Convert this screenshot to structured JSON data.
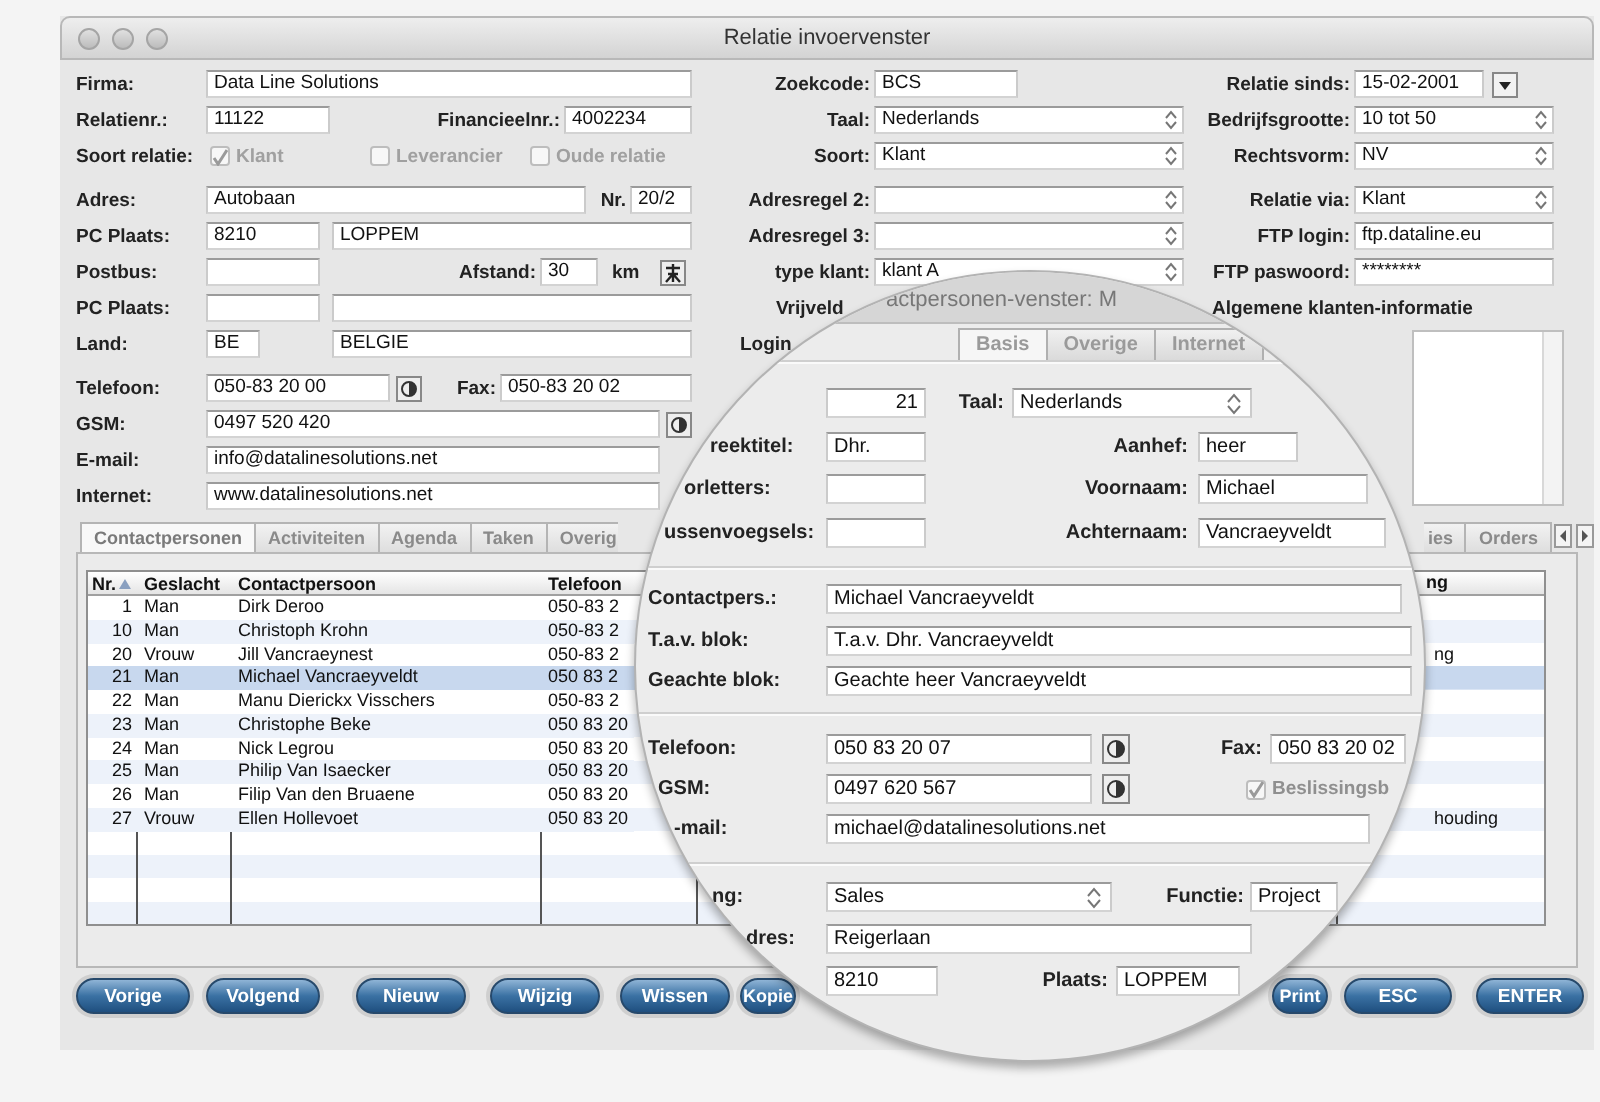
{
  "window": {
    "title": "Relatie invoervenster"
  },
  "form": {
    "left": [
      [
        {
          "kind": "label",
          "text": "Firma:"
        },
        {
          "kind": "field",
          "value": "Data Line Solutions"
        }
      ],
      [
        {
          "kind": "label",
          "text": "Relatienr.:"
        },
        {
          "kind": "field",
          "value": "11122"
        },
        {
          "kind": "label",
          "text": "Financieelnr.:"
        },
        {
          "kind": "field",
          "value": "4002234"
        }
      ],
      [
        {
          "kind": "label",
          "text": "Soort relatie:"
        },
        {
          "kind": "check",
          "text": "Klant",
          "checked": true,
          "disabled": true
        },
        {
          "kind": "check",
          "text": "Leverancier",
          "checked": false,
          "disabled": true
        },
        {
          "kind": "check",
          "text": "Oude relatie",
          "checked": false,
          "disabled": true
        }
      ],
      [
        {
          "kind": "label",
          "text": "Adres:"
        },
        {
          "kind": "field",
          "value": "Autobaan"
        },
        {
          "kind": "label",
          "text": "Nr."
        },
        {
          "kind": "field",
          "value": "20/2"
        }
      ],
      [
        {
          "kind": "label",
          "text": "PC Plaats:"
        },
        {
          "kind": "field",
          "value": "8210"
        },
        {
          "kind": "field",
          "value": "LOPPEM"
        }
      ],
      [
        {
          "kind": "label",
          "text": "Postbus:"
        },
        {
          "kind": "field"
        },
        {
          "kind": "label",
          "text": "Afstand:"
        },
        {
          "kind": "field",
          "value": "30"
        },
        {
          "kind": "label",
          "text": "km"
        },
        {
          "kind": "icon"
        }
      ],
      [
        {
          "kind": "label",
          "text": "PC Plaats:"
        },
        {
          "kind": "field"
        },
        {
          "kind": "field"
        }
      ],
      [
        {
          "kind": "label",
          "text": "Land:"
        },
        {
          "kind": "field",
          "value": "BE"
        },
        {
          "kind": "field",
          "value": "BELGIE"
        }
      ],
      [
        {
          "kind": "label",
          "text": "Telefoon:"
        },
        {
          "kind": "field",
          "value": "050-83 20 00"
        },
        {
          "kind": "phone"
        },
        {
          "kind": "label",
          "text": "Fax:"
        },
        {
          "kind": "field",
          "value": "050-83 20 02"
        }
      ],
      [
        {
          "kind": "label",
          "text": "GSM:"
        },
        {
          "kind": "field",
          "value": "0497 520 420"
        },
        {
          "kind": "phone"
        }
      ],
      [
        {
          "kind": "label",
          "text": "E-mail:"
        },
        {
          "kind": "field",
          "value": "info@datalinesolutions.net"
        }
      ],
      [
        {
          "kind": "label",
          "text": "Internet:"
        },
        {
          "kind": "field",
          "value": "www.datalinesolutions.net"
        }
      ]
    ],
    "middle": [
      [
        {
          "kind": "label",
          "text": "Zoekcode:"
        },
        {
          "kind": "field",
          "value": "BCS"
        }
      ],
      [
        {
          "kind": "label",
          "text": "Taal:"
        },
        {
          "kind": "select",
          "value": "Nederlands"
        }
      ],
      [
        {
          "kind": "label",
          "text": "Soort:"
        },
        {
          "kind": "select",
          "value": "Klant"
        }
      ],
      [
        {
          "kind": "label",
          "text": "Adresregel 2:"
        },
        {
          "kind": "select"
        }
      ],
      [
        {
          "kind": "label",
          "text": "Adresregel 3:"
        },
        {
          "kind": "select"
        }
      ],
      [
        {
          "kind": "label",
          "text": "type klant:"
        },
        {
          "kind": "select",
          "value": "klant A"
        }
      ],
      [
        {
          "kind": "label",
          "text": "Vrijveld"
        }
      ],
      [
        {
          "kind": "label",
          "text": "Login"
        }
      ]
    ],
    "right": [
      [
        {
          "kind": "label",
          "text": "Relatie sinds:"
        },
        {
          "kind": "date",
          "value": "15-02-2001"
        }
      ],
      [
        {
          "kind": "label",
          "text": "Bedrijfsgrootte:"
        },
        {
          "kind": "select",
          "value": "10 tot 50"
        }
      ],
      [
        {
          "kind": "label",
          "text": "Rechtsvorm:"
        },
        {
          "kind": "select",
          "value": "NV"
        }
      ],
      [
        {
          "kind": "label",
          "text": "Relatie via:"
        },
        {
          "kind": "select",
          "value": "Klant"
        }
      ],
      [
        {
          "kind": "label",
          "text": "FTP login:"
        },
        {
          "kind": "field",
          "value": "ftp.dataline.eu"
        }
      ],
      [
        {
          "kind": "label",
          "text": "FTP paswoord:"
        },
        {
          "kind": "field",
          "value": "********"
        }
      ],
      [
        {
          "kind": "label",
          "text": "Algemene klanten-informatie"
        }
      ]
    ]
  },
  "tabs": [
    {
      "label": "Contactpersonen",
      "selected": true
    },
    {
      "label": "Activiteiten",
      "selected": false
    },
    {
      "label": "Agenda",
      "selected": false
    },
    {
      "label": "Taken",
      "selected": false
    },
    {
      "label": "Overig",
      "selected": false
    }
  ],
  "tabs_end": [
    {
      "label": "ies",
      "selected": false
    },
    {
      "label": "Orders",
      "selected": false
    }
  ],
  "table": {
    "columns": [
      "Nr.",
      "Geslacht",
      "Contactpersoon",
      "Telefoon"
    ],
    "last_column": "ng",
    "rows": [
      {
        "cells": [
          "1",
          "Man",
          "Dirk Deroo",
          "050-83 2"
        ],
        "selected": false
      },
      {
        "cells": [
          "10",
          "Man",
          "Christoph Krohn",
          "050-83 2"
        ],
        "selected": false
      },
      {
        "cells": [
          "20",
          "Vrouw",
          "Jill Vancraeynest",
          "050-83 2"
        ],
        "last": "ng",
        "selected": false
      },
      {
        "cells": [
          "21",
          "Man",
          "Michael Vancraeyveldt",
          "050 83 2"
        ],
        "selected": true
      },
      {
        "cells": [
          "22",
          "Man",
          "Manu Dierickx Visschers",
          "050-83 2"
        ],
        "selected": false
      },
      {
        "cells": [
          "23",
          "Man",
          "Christophe Beke",
          "050 83 20"
        ],
        "selected": false
      },
      {
        "cells": [
          "24",
          "Man",
          "Nick Legrou",
          "050 83 20"
        ],
        "selected": false
      },
      {
        "cells": [
          "25",
          "Man",
          "Philip Van Isaecker",
          "050 83 20"
        ],
        "selected": false
      },
      {
        "cells": [
          "26",
          "Man",
          "Filip Van den Bruaene",
          "050 83 20"
        ],
        "selected": false
      },
      {
        "cells": [
          "27",
          "Vrouw",
          "Ellen Hollevoet",
          "050 83 20"
        ],
        "last": "houding",
        "selected": false
      }
    ]
  },
  "buttons": [
    "Vorige",
    "Volgend",
    "Nieuw",
    "Wijzig",
    "Wissen",
    "Kopie",
    "Print",
    "ESC",
    "ENTER"
  ],
  "magnifier": {
    "title": "actpersonen-venster: M",
    "tabs": [
      {
        "label": "Basis",
        "selected": true
      },
      {
        "label": "Overige",
        "selected": false
      },
      {
        "label": "Internet",
        "selected": false
      }
    ],
    "items": [
      {
        "kind": "field",
        "value": "21"
      },
      {
        "kind": "label",
        "text": "Taal:"
      },
      {
        "kind": "select",
        "value": "Nederlands"
      },
      {
        "kind": "label",
        "text": "reektitel:"
      },
      {
        "kind": "field",
        "value": "Dhr."
      },
      {
        "kind": "label",
        "text": "Aanhef:"
      },
      {
        "kind": "field",
        "value": "heer"
      },
      {
        "kind": "label",
        "text": "orletters:"
      },
      {
        "kind": "field"
      },
      {
        "kind": "label",
        "text": "Voornaam:"
      },
      {
        "kind": "field",
        "value": "Michael"
      },
      {
        "kind": "label",
        "text": "ussenvoegsels:"
      },
      {
        "kind": "field"
      },
      {
        "kind": "label",
        "text": "Achternaam:"
      },
      {
        "kind": "field",
        "value": "Vancraeyveldt"
      },
      {
        "kind": "label",
        "text": "Contactpers.:"
      },
      {
        "kind": "field",
        "value": "Michael Vancraeyveldt"
      },
      {
        "kind": "label",
        "text": "T.a.v. blok:"
      },
      {
        "kind": "field",
        "value": "T.a.v. Dhr. Vancraeyveldt"
      },
      {
        "kind": "label",
        "text": "Geachte blok:"
      },
      {
        "kind": "field",
        "value": "Geachte heer Vancraeyveldt"
      },
      {
        "kind": "label",
        "text": "Telefoon:"
      },
      {
        "kind": "field",
        "value": "050 83 20 07"
      },
      {
        "kind": "phone"
      },
      {
        "kind": "label",
        "text": "Fax:"
      },
      {
        "kind": "field",
        "value": "050 83 20 02"
      },
      {
        "kind": "label",
        "text": "GSM:"
      },
      {
        "kind": "field",
        "value": "0497 620 567"
      },
      {
        "kind": "phone"
      },
      {
        "kind": "check",
        "text": "Beslissingsb",
        "checked": true,
        "disabled": true
      },
      {
        "kind": "label",
        "text": "-mail:"
      },
      {
        "kind": "field",
        "value": "michael@datalinesolutions.net"
      },
      {
        "kind": "label",
        "text": "ng:"
      },
      {
        "kind": "select",
        "value": "Sales"
      },
      {
        "kind": "label",
        "text": "Functie:"
      },
      {
        "kind": "field",
        "value": "Project"
      },
      {
        "kind": "label",
        "text": "dres:"
      },
      {
        "kind": "field",
        "value": "Reigerlaan"
      },
      {
        "kind": "field",
        "value": "8210"
      },
      {
        "kind": "label",
        "text": "Plaats:"
      },
      {
        "kind": "field",
        "value": "LOPPEM"
      }
    ]
  }
}
